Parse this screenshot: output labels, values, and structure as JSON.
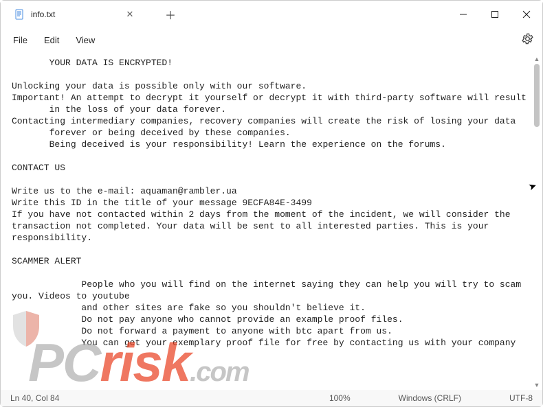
{
  "titlebar": {
    "tab_title": "info.txt"
  },
  "menubar": {
    "file": "File",
    "edit": "Edit",
    "view": "View"
  },
  "document": {
    "text": "       YOUR DATA IS ENCRYPTED!\n\nUnlocking your data is possible only with our software.\nImportant! An attempt to decrypt it yourself or decrypt it with third-party software will result\n       in the loss of your data forever.\nContacting intermediary companies, recovery companies will create the risk of losing your data\n       forever or being deceived by these companies.\n       Being deceived is your responsibility! Learn the experience on the forums.\n\nCONTACT US\n\nWrite us to the e-mail: aquaman@rambler.ua\nWrite this ID in the title of your message 9ECFA84E-3499\nIf you have not contacted within 2 days from the moment of the incident, we will consider the transaction not completed. Your data will be sent to all interested parties. This is your responsibility.\n\nSCAMMER ALERT\n\n             People who you will find on the internet saying they can help you will try to scam you. Videos to youtube\n             and other sites are fake so you shouldn't believe it.\n             Do not pay anyone who cannot provide an example proof files.\n             Do not forward a payment to anyone with btc apart from us.\n             You can get your exemplary proof file for free by contacting us with your company"
  },
  "statusbar": {
    "position": "Ln 40, Col 84",
    "zoom": "100%",
    "eol": "Windows (CRLF)",
    "encoding": "UTF-8"
  },
  "watermark": {
    "pc": "PC",
    "risk": "risk",
    "com": ".com"
  }
}
